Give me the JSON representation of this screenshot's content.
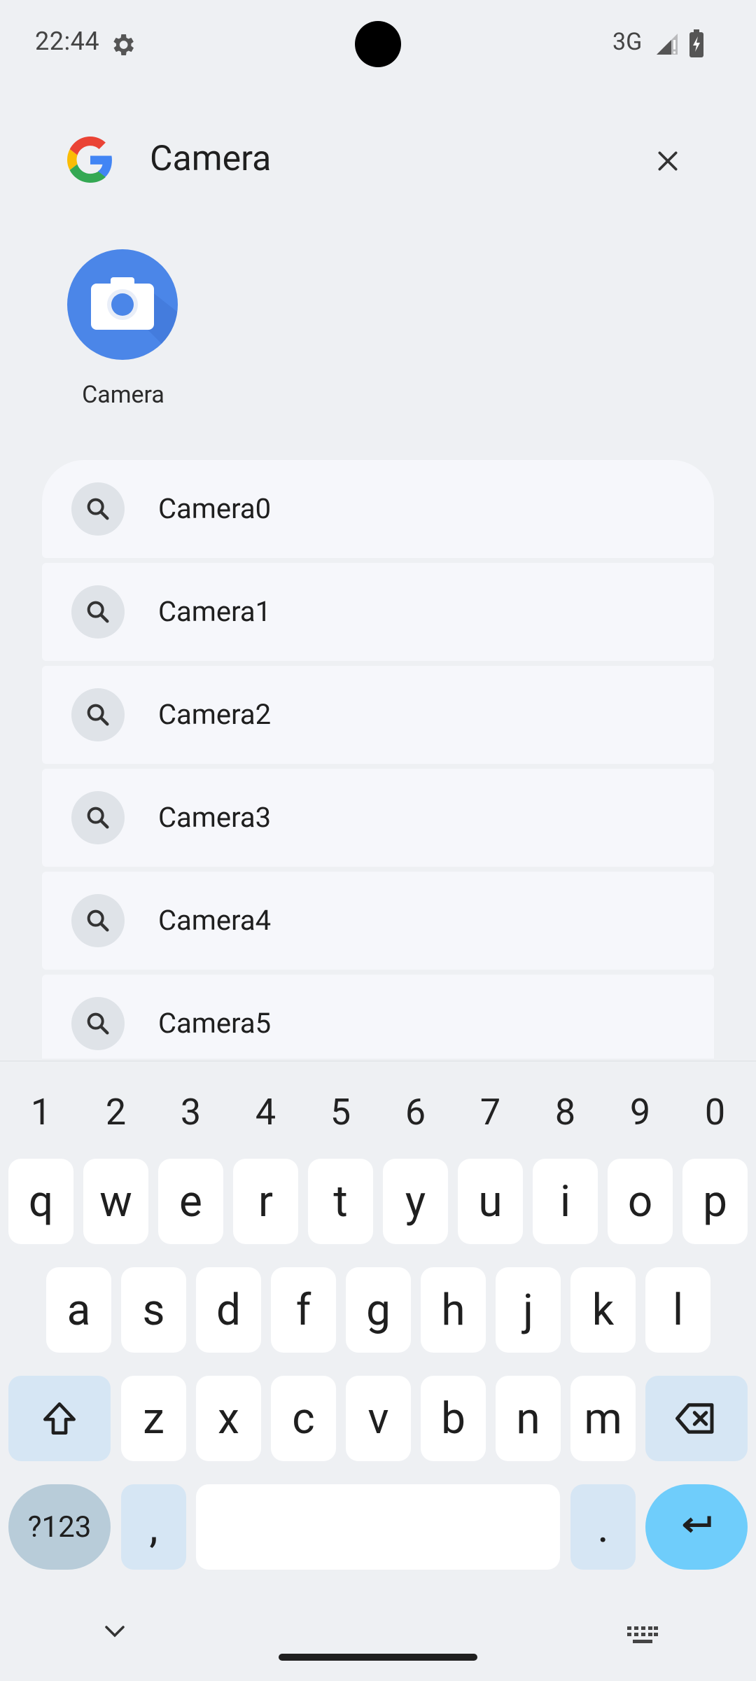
{
  "status_bar": {
    "time": "22:44",
    "network": "3G"
  },
  "search": {
    "query": "Camera"
  },
  "app_result": {
    "label": "Camera"
  },
  "suggestions": [
    "Camera0",
    "Camera1",
    "Camera2",
    "Camera3",
    "Camera4",
    "Camera5"
  ],
  "keyboard": {
    "numbers": [
      "1",
      "2",
      "3",
      "4",
      "5",
      "6",
      "7",
      "8",
      "9",
      "0"
    ],
    "row1": [
      "q",
      "w",
      "e",
      "r",
      "t",
      "y",
      "u",
      "i",
      "o",
      "p"
    ],
    "row2": [
      "a",
      "s",
      "d",
      "f",
      "g",
      "h",
      "j",
      "k",
      "l"
    ],
    "row3": [
      "z",
      "x",
      "c",
      "v",
      "b",
      "n",
      "m"
    ],
    "symbols_key": "?123",
    "comma": ",",
    "period": "."
  },
  "colors": {
    "background": "#eef0f3",
    "suggestion_bg": "#f6f7fb",
    "app_icon_blue": "#4b86e8",
    "func_key": "#d6e6f4",
    "enter_key": "#6fcdfb",
    "symbols_key": "#b8ccd9"
  },
  "icons": [
    "settings-gear-icon",
    "signal-icon",
    "battery-charging-icon",
    "google-logo",
    "close-icon",
    "camera-app-icon",
    "search-icon",
    "shift-icon",
    "backspace-icon",
    "enter-icon",
    "chevron-down-icon",
    "keyboard-icon"
  ]
}
